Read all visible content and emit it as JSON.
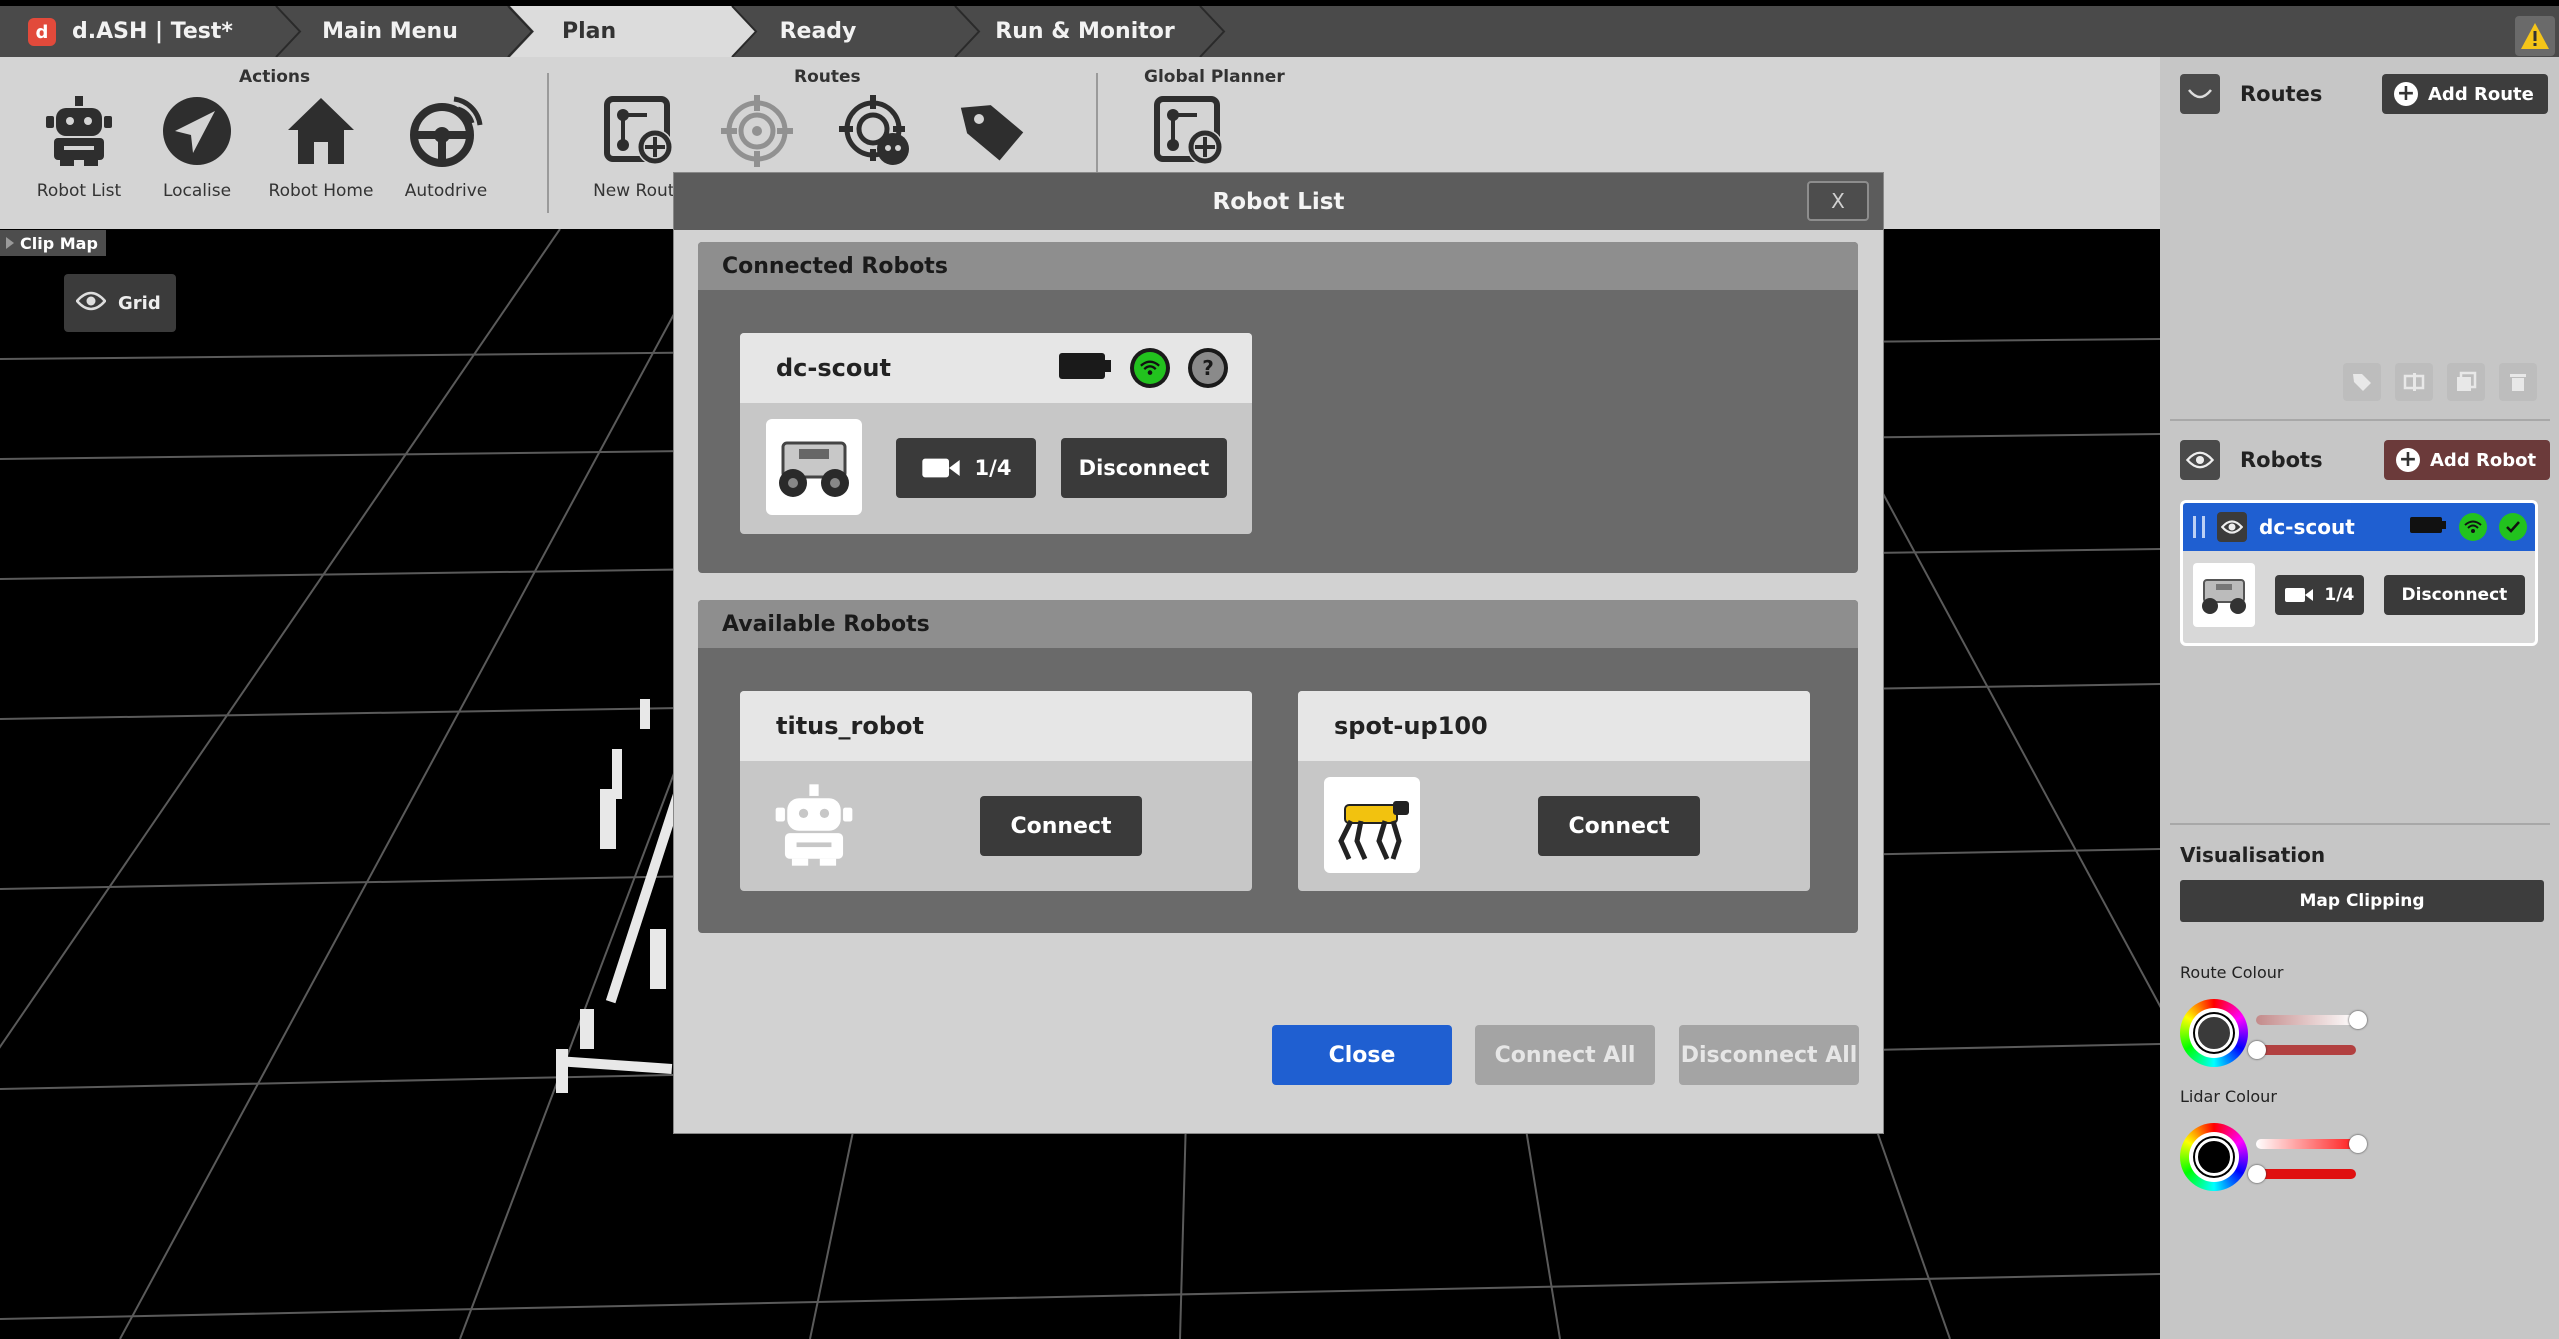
{
  "app": {
    "title": "d.ASH | Test*",
    "logo_text": "d"
  },
  "breadcrumbs": [
    "Main Menu",
    "Plan",
    "Ready",
    "Run & Monitor"
  ],
  "toolbar": {
    "groups": {
      "actions": "Actions",
      "routes": "Routes",
      "global_planner": "Global Planner"
    },
    "tools": {
      "robot_list": "Robot List",
      "localise": "Localise",
      "robot_home": "Robot Home",
      "autodrive": "Autodrive",
      "new_route": "New Route"
    }
  },
  "viewport": {
    "clip_map": "Clip Map",
    "grid": "Grid"
  },
  "right_panel": {
    "routes_title": "Routes",
    "add_route": "Add Route",
    "robots_title": "Robots",
    "add_robot": "Add Robot",
    "robot_card": {
      "name": "dc-scout",
      "camera": "1/4",
      "disconnect": "Disconnect"
    },
    "visualisation_title": "Visualisation",
    "map_clipping": "Map Clipping",
    "route_colour": "Route Colour",
    "lidar_colour": "Lidar Colour"
  },
  "modal": {
    "title": "Robot List",
    "close_x": "X",
    "connected_title": "Connected Robots",
    "connected": [
      {
        "name": "dc-scout",
        "camera": "1/4",
        "action": "Disconnect"
      }
    ],
    "available_title": "Available Robots",
    "available": [
      {
        "name": "titus_robot",
        "action": "Connect"
      },
      {
        "name": "spot-up100",
        "action": "Connect"
      }
    ],
    "footer": {
      "close": "Close",
      "connect_all": "Connect All",
      "disconnect_all": "Disconnect All"
    }
  },
  "colors": {
    "accent_blue": "#1f5fd1",
    "wifi_green": "#22c21e",
    "add_robot_bg": "#6b3a3a",
    "warning_yellow": "#f5c518"
  }
}
